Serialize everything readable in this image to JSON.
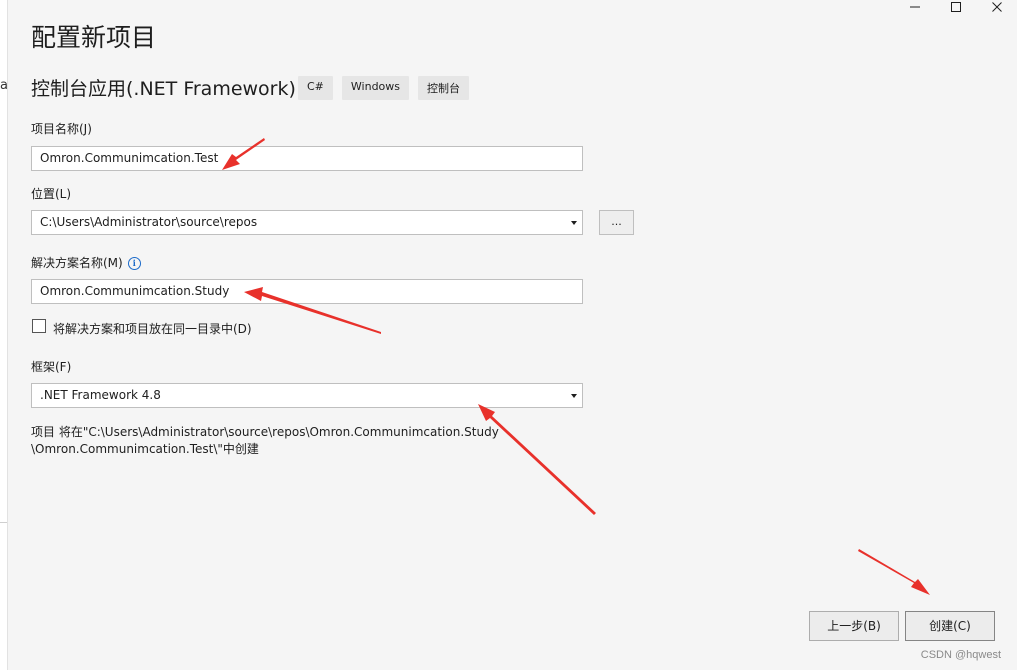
{
  "window": {
    "title": "配置新项目",
    "controls": {
      "minimize_icon": "minimize-icon",
      "maximize_icon": "maximize-icon",
      "close_icon": "close-icon"
    }
  },
  "template": {
    "name": "控制台应用(.NET Framework)",
    "tags": [
      "C#",
      "Windows",
      "控制台"
    ]
  },
  "form": {
    "project_name_label": "项目名称(J)",
    "project_name_value": "Omron.Communimcation.Test",
    "location_label": "位置(L)",
    "location_value": "C:\\Users\\Administrator\\source\\repos",
    "browse_label": "...",
    "solution_name_label": "解决方案名称(M)",
    "solution_info_icon": "info-icon",
    "solution_name_value": "Omron.Communimcation.Study",
    "same_dir_label": "将解决方案和项目放在同一目录中(D)",
    "same_dir_checked": false,
    "framework_label": "框架(F)",
    "framework_value": ".NET Framework 4.8",
    "path_note_line1": "项目 将在\"C:\\Users\\Administrator\\source\\repos\\Omron.Communimcation.Study",
    "path_note_line2": "\\Omron.Communimcation.Test\\\"中创建"
  },
  "footer": {
    "back_label": "上一步(B)",
    "create_label": "创建(C)"
  },
  "left_edge_fragment": "ar",
  "watermark": "CSDN @hqwest",
  "colors": {
    "annotation_arrow": "#e8312b",
    "info_icon": "#1b6ac9",
    "background": "#f5f5f5"
  }
}
